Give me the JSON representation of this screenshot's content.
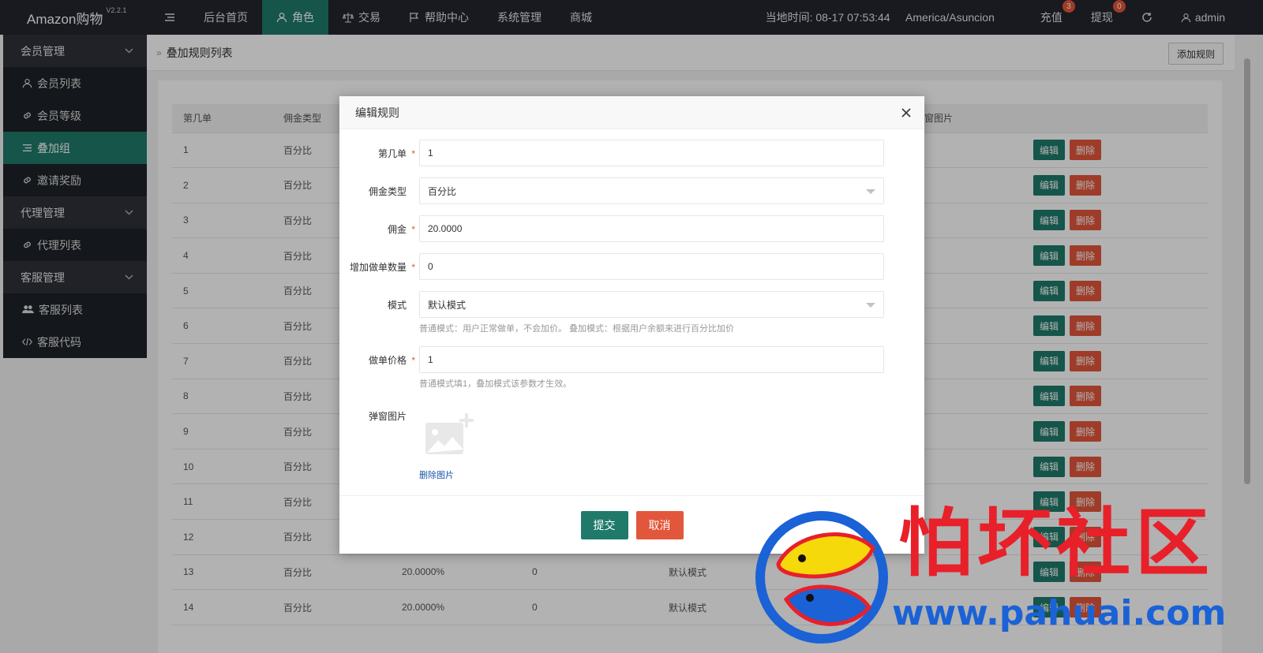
{
  "header": {
    "brand": "Amazon购物",
    "version": "V2.2.1",
    "nav": [
      {
        "label": "后台首页",
        "icon": "home-icon"
      },
      {
        "label": "角色",
        "icon": "user-icon",
        "active": true
      },
      {
        "label": "交易",
        "icon": "balance-icon"
      },
      {
        "label": "帮助中心",
        "icon": "flag-icon"
      },
      {
        "label": "系统管理"
      },
      {
        "label": "商城"
      }
    ],
    "time_label": "当地时间:",
    "time_value": "08-17 07:53:44",
    "timezone": "America/Asuncion",
    "recharge": {
      "label": "充值",
      "badge": "3"
    },
    "withdraw": {
      "label": "提现",
      "badge": "0"
    },
    "user": "admin"
  },
  "sidebar": {
    "groups": [
      {
        "label": "会员管理",
        "items": [
          {
            "label": "会员列表",
            "icon": "user-icon"
          },
          {
            "label": "会员等级",
            "icon": "link-icon"
          },
          {
            "label": "叠加组",
            "icon": "list-icon",
            "active": true
          },
          {
            "label": "邀请奖励",
            "icon": "link-icon"
          }
        ]
      },
      {
        "label": "代理管理",
        "items": [
          {
            "label": "代理列表",
            "icon": "link-icon"
          }
        ]
      },
      {
        "label": "客服管理",
        "items": [
          {
            "label": "客服列表",
            "icon": "users-icon"
          },
          {
            "label": "客服代码",
            "icon": "code-icon"
          }
        ]
      }
    ]
  },
  "page": {
    "title": "叠加规则列表",
    "add_button": "添加规则"
  },
  "table": {
    "columns": [
      "第几单",
      "佣金类型",
      "",
      "",
      "",
      "",
      "弹窗图片",
      ""
    ],
    "rows": [
      {
        "n": "1",
        "type": "百分比",
        "commission": "",
        "count": "",
        "mode": ""
      },
      {
        "n": "2",
        "type": "百分比",
        "commission": "",
        "count": "",
        "mode": ""
      },
      {
        "n": "3",
        "type": "百分比",
        "commission": "",
        "count": "",
        "mode": ""
      },
      {
        "n": "4",
        "type": "百分比",
        "commission": "",
        "count": "",
        "mode": ""
      },
      {
        "n": "5",
        "type": "百分比",
        "commission": "",
        "count": "",
        "mode": ""
      },
      {
        "n": "6",
        "type": "百分比",
        "commission": "",
        "count": "",
        "mode": ""
      },
      {
        "n": "7",
        "type": "百分比",
        "commission": "",
        "count": "",
        "mode": ""
      },
      {
        "n": "8",
        "type": "百分比",
        "commission": "",
        "count": "",
        "mode": ""
      },
      {
        "n": "9",
        "type": "百分比",
        "commission": "",
        "count": "",
        "mode": ""
      },
      {
        "n": "10",
        "type": "百分比",
        "commission": "",
        "count": "",
        "mode": ""
      },
      {
        "n": "11",
        "type": "百分比",
        "commission": "",
        "count": "",
        "mode": ""
      },
      {
        "n": "12",
        "type": "百分比",
        "commission": "",
        "count": "",
        "mode": ""
      },
      {
        "n": "13",
        "type": "百分比",
        "commission": "20.0000%",
        "count": "0",
        "mode": "默认模式"
      },
      {
        "n": "14",
        "type": "百分比",
        "commission": "20.0000%",
        "count": "0",
        "mode": "默认模式"
      }
    ],
    "edit_label": "编辑",
    "delete_label": "删除"
  },
  "modal": {
    "title": "编辑规则",
    "fields": {
      "order_no": {
        "label": "第几单",
        "value": "1"
      },
      "commission_type": {
        "label": "佣金类型",
        "value": "百分比"
      },
      "commission": {
        "label": "佣金",
        "value": "20.0000"
      },
      "add_count": {
        "label": "增加做单数量",
        "value": "0"
      },
      "mode": {
        "label": "模式",
        "value": "默认模式",
        "help": "普通模式：用户正常做单，不会加价。 叠加模式：根据用户余额来进行百分比加价"
      },
      "price": {
        "label": "做单价格",
        "value": "1",
        "help": "普通模式填1，叠加模式该参数才生效。"
      },
      "image": {
        "label": "弹窗图片",
        "delete_label": "删除图片"
      }
    },
    "submit": "提交",
    "cancel": "取消"
  },
  "watermark": {
    "text": "怕坏社区",
    "url": "www.pahuai.com"
  },
  "colors": {
    "header_bg": "#23262e",
    "accent": "#1f7a6a",
    "danger": "#e2573b",
    "link": "#1a58a8"
  }
}
